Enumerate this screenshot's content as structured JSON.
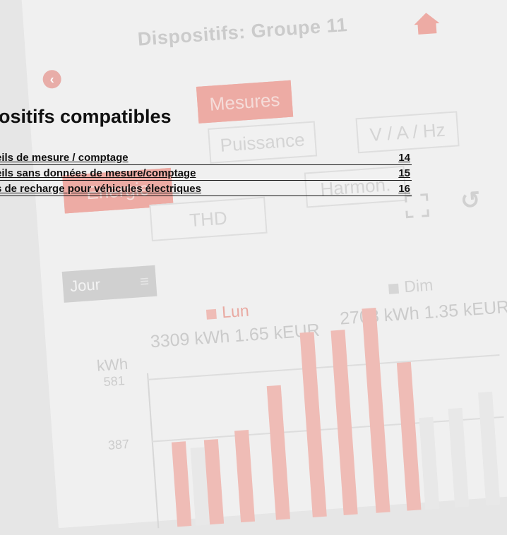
{
  "background_app": {
    "title": "Dispositifs: Groupe 11",
    "back_glyph": "‹",
    "tabs": [
      "Mesures",
      "Puissance",
      "V / A / Hz",
      "Energie",
      "Harmon.",
      "THD"
    ],
    "period": "Jour",
    "legend_lun": "Lun",
    "legend_dim": "Dim",
    "kpi_lun": "3309 kWh 1.65 kEUR",
    "kpi_dim": "2708 kWh 1.35 kEUR",
    "axis_unit": "kWh",
    "y_ticks": [
      "581",
      "387"
    ],
    "accent": "#eea79f"
  },
  "document": {
    "title": "ositifs compatibles",
    "toc": [
      {
        "title": "eils de mesure / comptage",
        "page": "14"
      },
      {
        "title": "eils sans données de mesure/comptage",
        "page": "15"
      },
      {
        "title": "s de recharge pour véhicules électriques",
        "page": "16"
      }
    ]
  }
}
